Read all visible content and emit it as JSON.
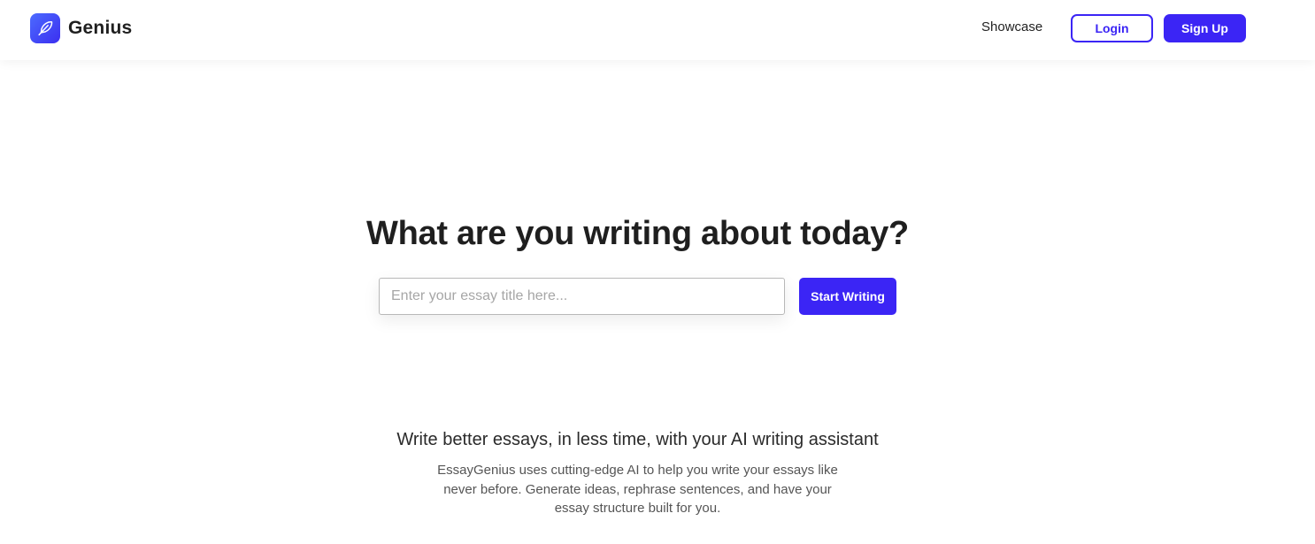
{
  "header": {
    "logo_text": "Genius",
    "logo_icon": "feather-icon",
    "nav_showcase": "Showcase",
    "login_label": "Login",
    "signup_label": "Sign Up"
  },
  "hero": {
    "title": "What are you writing about today?",
    "input_placeholder": "Enter your essay title here...",
    "input_value": "",
    "start_button_label": "Start Writing"
  },
  "features": {
    "heading": "Write better essays, in less time, with your AI writing assistant",
    "description": "EssayGenius uses cutting-edge AI to help you write your essays like never before. Generate ideas, rephrase sentences, and have your essay structure built for you."
  },
  "colors": {
    "accent": "#3b25f5",
    "logo_gradient_start": "#4c6bff",
    "logo_gradient_end": "#3b2ef0",
    "text_primary": "#1f1f1f",
    "text_secondary": "#555555"
  }
}
